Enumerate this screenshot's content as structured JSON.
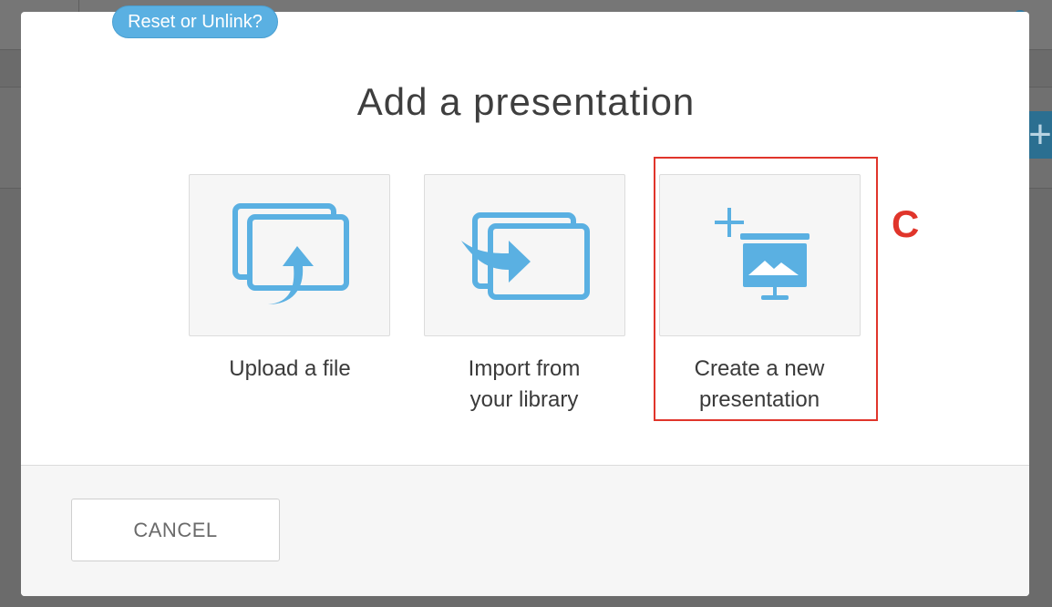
{
  "modal": {
    "title": "Add a presentation",
    "reset_link_label": "Reset or Unlink?",
    "options": [
      {
        "label": "Upload a file",
        "icon": "upload-file-icon"
      },
      {
        "label": "Import from\nyour library",
        "icon": "import-library-icon"
      },
      {
        "label": "Create a new\npresentation",
        "icon": "new-presentation-icon"
      }
    ],
    "cancel_label": "CANCEL"
  },
  "annotation": {
    "letter": "C",
    "highlighted_option": "Create a new presentation"
  },
  "colors": {
    "accent": "#5ab0e2",
    "annotation_red": "#e0352b",
    "text": "#3a3a3a"
  }
}
